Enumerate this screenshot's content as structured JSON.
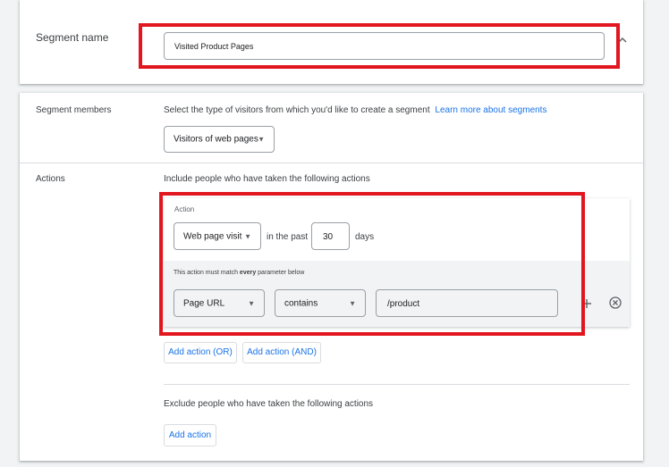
{
  "segment_name": {
    "label": "Segment name",
    "value": "Visited Product Pages"
  },
  "segment_members": {
    "label": "Segment members",
    "description": "Select the type of visitors from which you'd like to create a segment",
    "learn_more_link": "Learn more about segments",
    "dropdown_value": "Visitors of web pages"
  },
  "actions": {
    "label": "Actions",
    "include_text": "Include people who have taken the following actions",
    "action_caption": "Action",
    "action_type": "Web page visit",
    "in_the_past_text": "in the past",
    "days_value": "30",
    "days_text": "days",
    "parameter_note_prefix": "This action must match ",
    "parameter_note_bold": "every",
    "parameter_note_suffix": " parameter below",
    "parameter_field": "Page URL",
    "operator": "contains",
    "match_value": "/product",
    "add_or_button": "Add action (OR)",
    "add_and_button": "Add action (AND)",
    "exclude_text": "Exclude people who have taken the following actions",
    "add_action_button": "Add action"
  },
  "highlight_color": "#e2161f",
  "link_color": "#1a73e8",
  "icons": [
    "chevron-up-icon",
    "dropdown-caret-icon",
    "plus-icon",
    "remove-circle-icon"
  ]
}
